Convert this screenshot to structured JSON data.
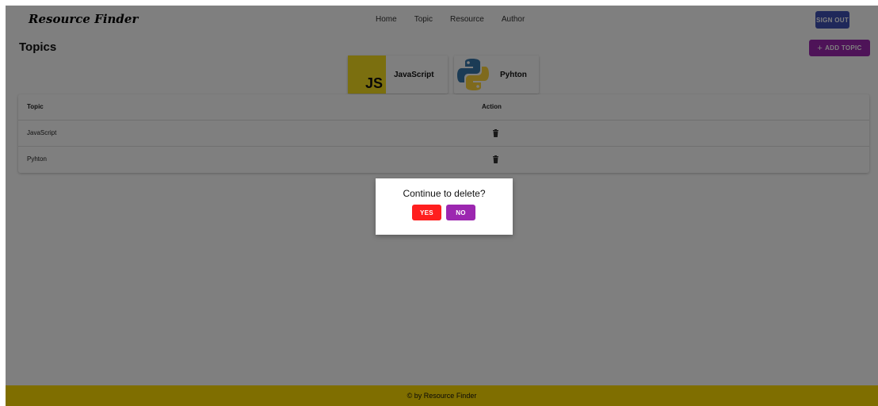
{
  "app": {
    "brand": "Resource Finder"
  },
  "nav": {
    "items": [
      "Home",
      "Topic",
      "Resource",
      "Author"
    ],
    "sign_out": "SIGN OUT"
  },
  "page": {
    "title": "Topics",
    "add_button": "ADD TOPIC",
    "add_icon": "plus-icon"
  },
  "cards": [
    {
      "label": "JavaScript",
      "logo_text": "JS",
      "icon": "javascript-logo"
    },
    {
      "label": "Pyhton",
      "icon": "python-logo"
    }
  ],
  "table": {
    "headers": [
      "Topic",
      "Action"
    ],
    "rows": [
      {
        "topic": "JavaScript",
        "action_icon": "trash-icon"
      },
      {
        "topic": "Pyhton",
        "action_icon": "trash-icon"
      }
    ]
  },
  "dialog": {
    "message": "Continue to delete?",
    "yes": "YES",
    "no": "NO"
  },
  "footer": {
    "text": "© by Resource Finder"
  },
  "colors": {
    "primary": "#3f51b5",
    "secondary": "#9c27b0",
    "danger": "#ff1f1f",
    "footer": "#ffdd00",
    "js_yellow": "#f7df1e"
  }
}
